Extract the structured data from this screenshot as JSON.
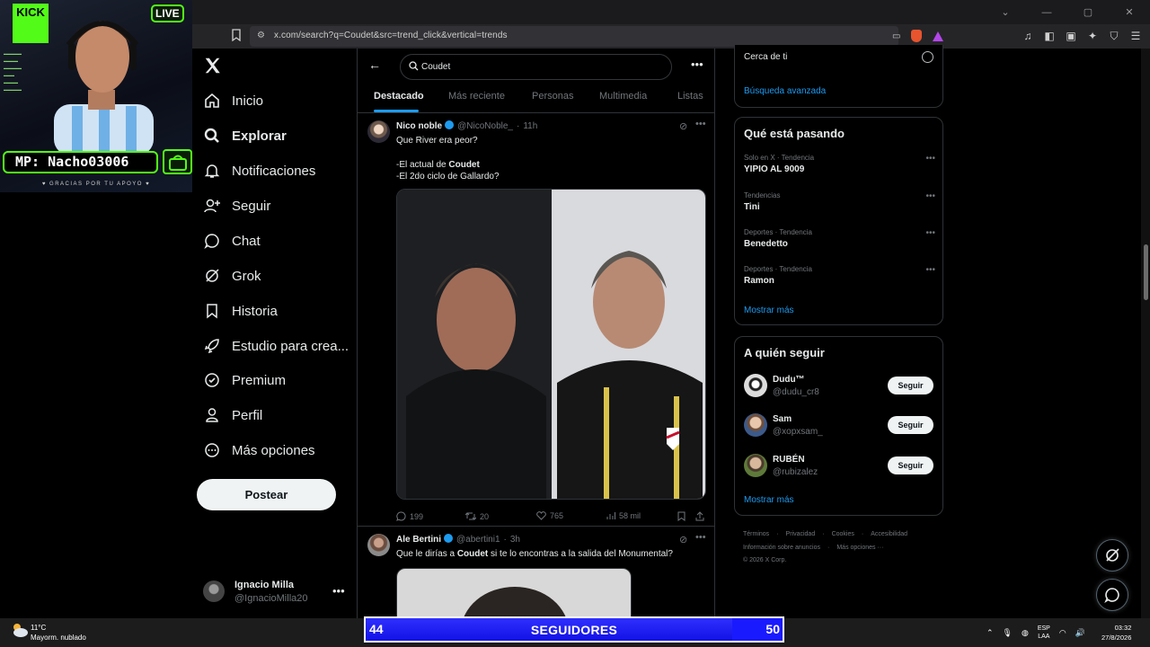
{
  "browser": {
    "url": "x.com/search?q=Coudet&src=trend_click&vertical=trends",
    "window_controls": [
      "⌄",
      "—",
      "▢",
      "✕"
    ]
  },
  "stream": {
    "platform": "KICK",
    "live_label": "LIVE",
    "mp_label": "MP: Nacho03006",
    "thanks": "♥ GRACIAS POR TU APOYO ♥",
    "goal": {
      "current": "44",
      "label": "SEGUIDORES",
      "target": "50",
      "progress": 0.88
    }
  },
  "nav": {
    "items": [
      {
        "label": "Inicio",
        "icon": "home-icon",
        "active": false
      },
      {
        "label": "Explorar",
        "icon": "search-icon",
        "active": true
      },
      {
        "label": "Notificaciones",
        "icon": "bell-icon",
        "active": false
      },
      {
        "label": "Seguir",
        "icon": "add-user-icon",
        "active": false
      },
      {
        "label": "Chat",
        "icon": "chat-icon",
        "active": false
      },
      {
        "label": "Grok",
        "icon": "grok-icon",
        "active": false
      },
      {
        "label": "Historia",
        "icon": "bookmark-icon",
        "active": false
      },
      {
        "label": "Estudio para crea...",
        "icon": "rocket-icon",
        "active": false
      },
      {
        "label": "Premium",
        "icon": "verified-icon",
        "active": false
      },
      {
        "label": "Perfil",
        "icon": "person-icon",
        "active": false
      },
      {
        "label": "Más opciones",
        "icon": "more-circle-icon",
        "active": false
      }
    ],
    "post_button": "Postear",
    "account": {
      "name": "Ignacio Milla",
      "handle": "@IgnacioMilla20"
    }
  },
  "search": {
    "query": "Coudet",
    "tabs": [
      "Destacado",
      "Más reciente",
      "Personas",
      "Multimedia",
      "Listas"
    ],
    "active_tab": "Destacado"
  },
  "tweets": [
    {
      "name": "Nico noble",
      "handle": "@NicoNoble_",
      "time": "11h",
      "line1": "Que River era peor?",
      "line2_pre": "-El actual de ",
      "line2_bold": "Coudet",
      "line3": "-El 2do ciclo de Gallardo?",
      "replies": "199",
      "retweets": "20",
      "likes": "765",
      "views": "58 mil"
    },
    {
      "name": "Ale Bertini",
      "handle": "@abertini1",
      "time": "3h",
      "text_pre": "Que le dirías a ",
      "text_bold": "Coudet",
      "text_post": " si te lo encontras a la salida del Monumental?"
    }
  ],
  "sidebar": {
    "near_label": "Cerca de ti",
    "advanced_search": "Búsqueda avanzada",
    "trends_title": "Qué está pasando",
    "trends": [
      {
        "meta": "Solo en X · Tendencia",
        "name": "YIPIO AL 9009"
      },
      {
        "meta": "Tendencias",
        "name": "Tini"
      },
      {
        "meta": "Deportes · Tendencia",
        "name": "Benedetto"
      },
      {
        "meta": "Deportes · Tendencia",
        "name": "Ramon"
      }
    ],
    "show_more": "Mostrar más",
    "follow_title": "A quién seguir",
    "follow": [
      {
        "name": "Dudu™",
        "handle": "@dudu_cr8",
        "button": "Seguir"
      },
      {
        "name": "Sam",
        "handle": "@xopxsam_",
        "button": "Seguir"
      },
      {
        "name": "RUBÉN",
        "handle": "@rubizalez",
        "button": "Seguir"
      }
    ],
    "footer": [
      "Términos",
      "Privacidad",
      "Cookies",
      "Accesibilidad",
      "Información sobre anuncios",
      "Más opciones ···",
      "© 2026 X Corp."
    ]
  },
  "taskbar": {
    "temp": "11°C",
    "condition": "Mayorm. nublado",
    "lang1": "ESP",
    "lang2": "LAA",
    "time": "03:32",
    "date": "27/8/2026"
  }
}
